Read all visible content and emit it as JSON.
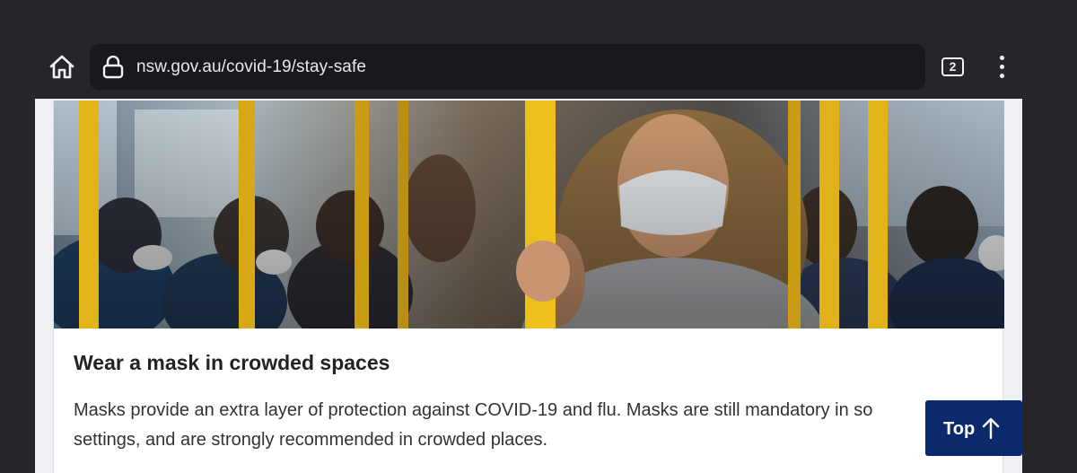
{
  "browser": {
    "url": "nsw.gov.au/covid-19/stay-safe",
    "tab_count": "2",
    "icons": {
      "home": "home-icon",
      "lock": "lock-icon",
      "tabs": "tab-switcher-icon",
      "menu": "more-vert-icon"
    }
  },
  "card": {
    "image_icon": "photo",
    "title": "Wear a mask in crowded spaces",
    "body_line1": "Masks provide an extra layer of protection against COVID-19 and flu. Masks are still mandatory in so",
    "body_line2": "settings, and are strongly recommended in crowded places."
  },
  "back_to_top": {
    "label": "Top",
    "icon": "arrow-up-icon",
    "color": "#0b2a6e"
  },
  "colors": {
    "chrome_bg": "#27252b",
    "urlbar_bg": "#19181c",
    "pole_yellow": "#e3b41a"
  }
}
